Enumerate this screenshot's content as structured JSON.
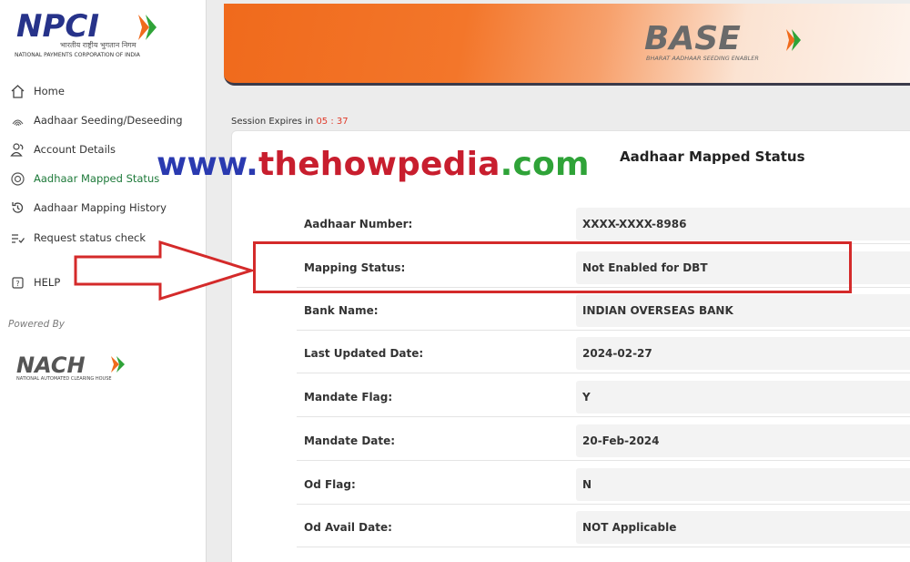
{
  "sidebar": {
    "npci_logo_text": "NPCI",
    "npci_hindi": "भारतीय राष्ट्रीय भुगतान निगम",
    "npci_subtitle": "NATIONAL PAYMENTS CORPORATION OF INDIA",
    "items": [
      {
        "label": "Home",
        "icon": "home-icon"
      },
      {
        "label": "Aadhaar Seeding/Deseeding",
        "icon": "fingerprint-icon"
      },
      {
        "label": "Account Details",
        "icon": "users-icon"
      },
      {
        "label": "Aadhaar Mapped Status",
        "icon": "target-icon",
        "active": true
      },
      {
        "label": "Aadhaar Mapping History",
        "icon": "history-icon"
      },
      {
        "label": "Request status check",
        "icon": "checklist-icon"
      },
      {
        "label": "HELP",
        "icon": "help-icon"
      }
    ],
    "powered_by": "Powered By",
    "nach_logo_text": "NACH",
    "nach_subtitle": "NATIONAL AUTOMATED CLEARING HOUSE"
  },
  "header": {
    "base_logo_text": "BASE",
    "base_subtitle": "BHARAT AADHAAR SEEDING ENABLER"
  },
  "session": {
    "label": "Session Expires in",
    "timer": "05 : 37"
  },
  "watermark": {
    "part1": "www.",
    "part2": "thehowpedia",
    "part3": ".com"
  },
  "card": {
    "title": "Aadhaar Mapped Status",
    "rows": [
      {
        "label": "Aadhaar Number:",
        "value": "XXXX-XXXX-8986"
      },
      {
        "label": "Mapping Status:",
        "value": "Not Enabled for DBT"
      },
      {
        "label": "Bank Name:",
        "value": "INDIAN OVERSEAS BANK"
      },
      {
        "label": "Last Updated Date:",
        "value": "2024-02-27"
      },
      {
        "label": "Mandate Flag:",
        "value": "Y"
      },
      {
        "label": "Mandate Date:",
        "value": "20-Feb-2024"
      },
      {
        "label": "Od Flag:",
        "value": "N"
      },
      {
        "label": "Od Avail Date:",
        "value": "NOT Applicable"
      }
    ]
  },
  "colors": {
    "accent_orange": "#f06a1c",
    "active_green": "#1e7a3a",
    "highlight_red": "#d42a2a",
    "npci_blue": "#27338a"
  }
}
